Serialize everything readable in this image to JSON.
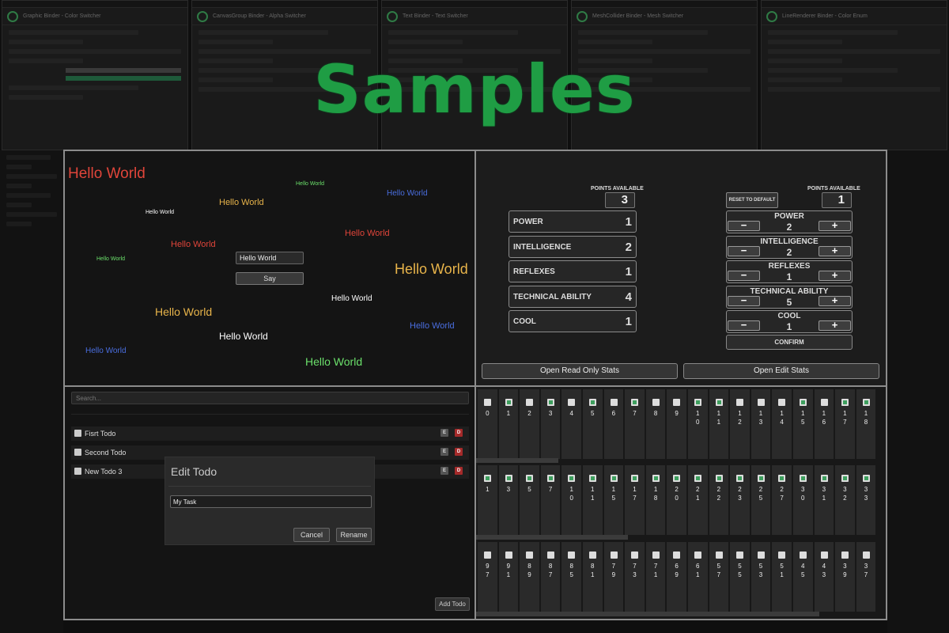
{
  "title": "Samples",
  "bg_panels": [
    "Graphic Binder - Color Switcher",
    "CanvasGroup Binder - Alpha Switcher",
    "Text Binder - Text Switcher",
    "MeshCollider Binder - Mesh Switcher",
    "LineRenderer Binder - Color Enum"
  ],
  "hello": {
    "input_value": "Hello World",
    "say_label": "Say",
    "texts": [
      "Hello World",
      "Hello World",
      "Hello World",
      "Hello World",
      "Hello World",
      "Hello World",
      "Hello World",
      "Hello World",
      "Hello World",
      "Hello World",
      "Hello World",
      "Hello World",
      "Hello World",
      "Hello World",
      "Hello World",
      "Hello World",
      "Hello World"
    ]
  },
  "stats": {
    "points_label": "POINTS AVAILABLE",
    "read_only_points": "3",
    "edit_points": "1",
    "read_only": [
      {
        "name": "POWER",
        "value": "1"
      },
      {
        "name": "INTELLIGENCE",
        "value": "2"
      },
      {
        "name": "REFLEXES",
        "value": "1"
      },
      {
        "name": "TECHNICAL ABILITY",
        "value": "4"
      },
      {
        "name": "COOL",
        "value": "1"
      }
    ],
    "editable": [
      {
        "name": "POWER",
        "value": "2"
      },
      {
        "name": "INTELLIGENCE",
        "value": "2"
      },
      {
        "name": "REFLEXES",
        "value": "1"
      },
      {
        "name": "TECHNICAL ABILITY",
        "value": "5"
      },
      {
        "name": "COOL",
        "value": "1"
      }
    ],
    "minus": "−",
    "plus": "+",
    "reset_label": "RESET TO DEFAULT",
    "confirm_label": "CONFIRM",
    "open_read_only": "Open Read Only Stats",
    "open_edit": "Open Edit Stats"
  },
  "todo": {
    "search_placeholder": "Search...",
    "items": [
      "Fisrt Todo",
      "Second Todo",
      "New Todo 3"
    ],
    "edit_label": "E",
    "delete_label": "D",
    "dialog_title": "Edit Todo",
    "dialog_value": "My Task",
    "cancel_label": "Cancel",
    "rename_label": "Rename",
    "add_label": "Add Todo"
  },
  "toggles": {
    "row1": [
      {
        "l": "0",
        "on": false
      },
      {
        "l": "1",
        "on": true
      },
      {
        "l": "2",
        "on": false
      },
      {
        "l": "3",
        "on": true
      },
      {
        "l": "4",
        "on": false
      },
      {
        "l": "5",
        "on": true
      },
      {
        "l": "6",
        "on": false
      },
      {
        "l": "7",
        "on": true
      },
      {
        "l": "8",
        "on": false
      },
      {
        "l": "9",
        "on": false
      },
      {
        "l": "10",
        "on": true
      },
      {
        "l": "11",
        "on": true
      },
      {
        "l": "12",
        "on": false
      },
      {
        "l": "13",
        "on": false
      },
      {
        "l": "14",
        "on": false
      },
      {
        "l": "15",
        "on": true
      },
      {
        "l": "16",
        "on": false
      },
      {
        "l": "17",
        "on": true
      },
      {
        "l": "18",
        "on": true
      }
    ],
    "row2": [
      {
        "l": "1",
        "on": true
      },
      {
        "l": "3",
        "on": true
      },
      {
        "l": "5",
        "on": true
      },
      {
        "l": "7",
        "on": true
      },
      {
        "l": "10",
        "on": true
      },
      {
        "l": "11",
        "on": true
      },
      {
        "l": "15",
        "on": true
      },
      {
        "l": "17",
        "on": true
      },
      {
        "l": "18",
        "on": true
      },
      {
        "l": "20",
        "on": true
      },
      {
        "l": "21",
        "on": true
      },
      {
        "l": "22",
        "on": true
      },
      {
        "l": "23",
        "on": true
      },
      {
        "l": "25",
        "on": true
      },
      {
        "l": "27",
        "on": true
      },
      {
        "l": "30",
        "on": true
      },
      {
        "l": "31",
        "on": true
      },
      {
        "l": "32",
        "on": true
      },
      {
        "l": "33",
        "on": true
      }
    ],
    "row3": [
      {
        "l": "97",
        "on": false
      },
      {
        "l": "91",
        "on": false
      },
      {
        "l": "89",
        "on": false
      },
      {
        "l": "87",
        "on": false
      },
      {
        "l": "85",
        "on": false
      },
      {
        "l": "81",
        "on": false
      },
      {
        "l": "79",
        "on": false
      },
      {
        "l": "73",
        "on": false
      },
      {
        "l": "71",
        "on": false
      },
      {
        "l": "69",
        "on": false
      },
      {
        "l": "61",
        "on": false
      },
      {
        "l": "57",
        "on": false
      },
      {
        "l": "55",
        "on": false
      },
      {
        "l": "53",
        "on": false
      },
      {
        "l": "51",
        "on": false
      },
      {
        "l": "45",
        "on": false
      },
      {
        "l": "43",
        "on": false
      },
      {
        "l": "39",
        "on": false
      },
      {
        "l": "37",
        "on": false
      }
    ]
  },
  "colors": {
    "title_green": "#1f9d44",
    "red": "#e0453a",
    "yellow": "#e8b44a",
    "blue": "#4a6ee0",
    "green": "#6be06b",
    "white": "#ffffff"
  }
}
